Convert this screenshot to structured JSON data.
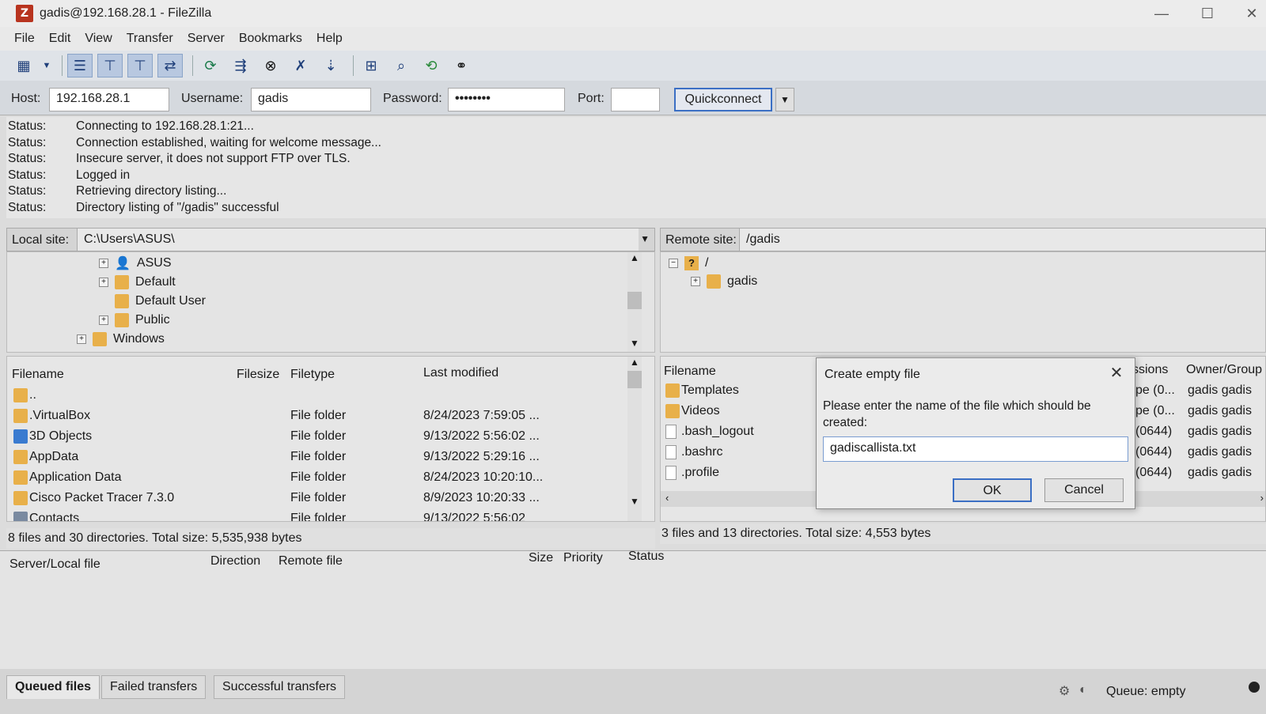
{
  "window": {
    "title": "gadis@192.168.28.1 - FileZilla"
  },
  "menu": [
    "File",
    "Edit",
    "View",
    "Transfer",
    "Server",
    "Bookmarks",
    "Help"
  ],
  "quickconnect": {
    "host_label": "Host:",
    "host": "192.168.28.1",
    "username_label": "Username:",
    "username": "gadis",
    "password_label": "Password:",
    "password": "••••••••",
    "port_label": "Port:",
    "port": "",
    "button": "Quickconnect"
  },
  "log": [
    {
      "label": "Status:",
      "text": "Connecting to 192.168.28.1:21..."
    },
    {
      "label": "Status:",
      "text": "Connection established, waiting for welcome message..."
    },
    {
      "label": "Status:",
      "text": "Insecure server, it does not support FTP over TLS."
    },
    {
      "label": "Status:",
      "text": "Logged in"
    },
    {
      "label": "Status:",
      "text": "Retrieving directory listing..."
    },
    {
      "label": "Status:",
      "text": "Directory listing of \"/gadis\" successful"
    }
  ],
  "local": {
    "site_label": "Local site:",
    "path": "C:\\Users\\ASUS\\",
    "tree": [
      "ASUS",
      "Default",
      "Default User",
      "Public",
      "Windows"
    ],
    "columns": {
      "filename": "Filename",
      "filesize": "Filesize",
      "filetype": "Filetype",
      "modified": "Last modified"
    },
    "rows": [
      {
        "name": "..",
        "type": "",
        "modified": ""
      },
      {
        "name": ".VirtualBox",
        "type": "File folder",
        "modified": "8/24/2023 7:59:05 ..."
      },
      {
        "name": "3D Objects",
        "type": "File folder",
        "modified": "9/13/2022 5:56:02 ..."
      },
      {
        "name": "AppData",
        "type": "File folder",
        "modified": "9/13/2022 5:29:16 ..."
      },
      {
        "name": "Application Data",
        "type": "File folder",
        "modified": "8/24/2023 10:20:10..."
      },
      {
        "name": "Cisco Packet Tracer 7.3.0",
        "type": "File folder",
        "modified": "8/9/2023 10:20:33 ..."
      },
      {
        "name": "Contacts",
        "type": "File folder",
        "modified": "9/13/2022 5:56:02"
      }
    ],
    "status": "8 files and 30 directories. Total size: 5,535,938 bytes"
  },
  "remote": {
    "site_label": "Remote site:",
    "path": "/gadis",
    "tree_root": "/",
    "tree_child": "gadis",
    "columns": {
      "filename": "Filename",
      "permissions": "ssions",
      "owner": "Owner/Group"
    },
    "rows": [
      {
        "name": "Templates",
        "perm": "pe (0...",
        "owner": "gadis gadis"
      },
      {
        "name": "Videos",
        "perm": "pe (0...",
        "owner": "gadis gadis"
      },
      {
        "name": ".bash_logout",
        "perm": "(0644)",
        "owner": "gadis gadis"
      },
      {
        "name": ".bashrc",
        "perm": "(0644)",
        "owner": "gadis gadis"
      },
      {
        "name": ".profile",
        "perm": "(0644)",
        "owner": "gadis gadis"
      }
    ],
    "status": "3 files and 13 directories. Total size: 4,553 bytes"
  },
  "queue": {
    "columns": {
      "server": "Server/Local file",
      "direction": "Direction",
      "remote": "Remote file",
      "size": "Size",
      "priority": "Priority",
      "status": "Status"
    },
    "tabs": [
      "Queued files",
      "Failed transfers",
      "Successful transfers"
    ],
    "status": "Queue: empty"
  },
  "dialog": {
    "title": "Create empty file",
    "prompt": "Please enter the name of the file which should be created:",
    "value": "gadiscallista.txt",
    "ok": "OK",
    "cancel": "Cancel"
  }
}
